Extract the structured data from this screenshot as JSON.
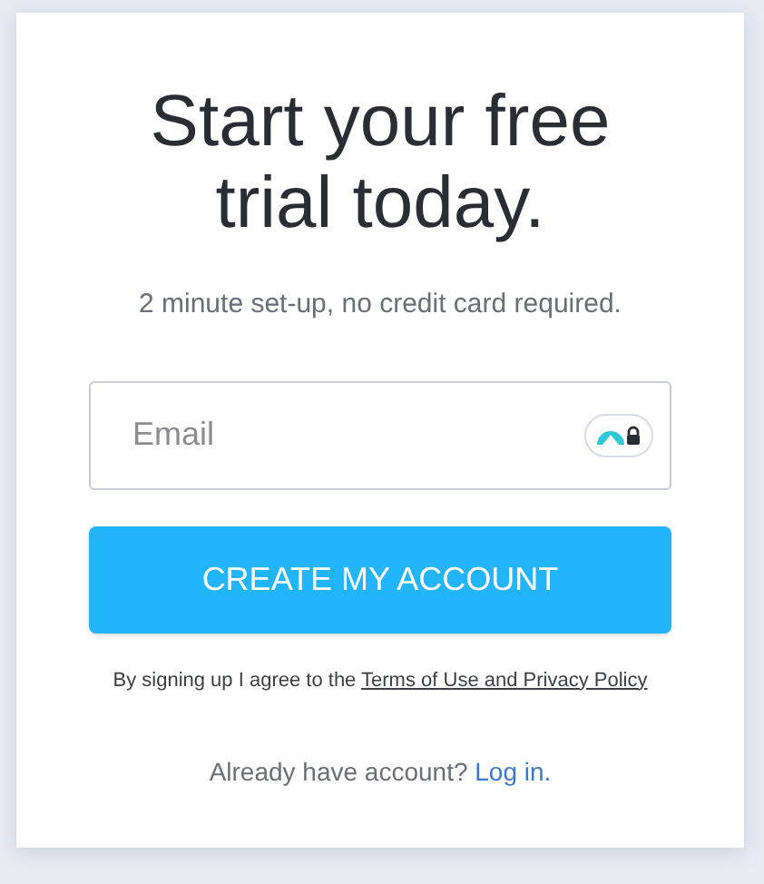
{
  "heading": "Start your free trial today.",
  "subheading": "2 minute set-up, no credit card required.",
  "email_field": {
    "placeholder": "Email"
  },
  "submit_button": "CREATE MY ACCOUNT",
  "terms": {
    "text": "By signing up I agree to the",
    "link": "Terms of Use and Privacy Policy"
  },
  "login": {
    "text": "Already have account?",
    "link": "Log in."
  }
}
